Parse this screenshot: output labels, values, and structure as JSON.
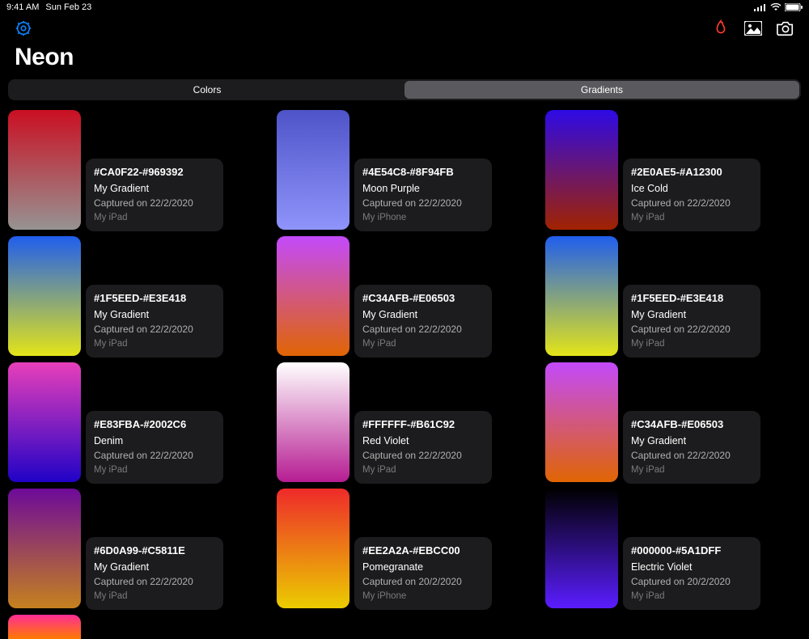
{
  "status": {
    "time": "9:41 AM",
    "date": "Sun Feb 23"
  },
  "title": "Neon",
  "segments": {
    "left": "Colors",
    "right": "Gradients"
  },
  "cards": [
    [
      {
        "c1": "#CA0F22",
        "c2": "#969392",
        "hex": "#CA0F22-#969392",
        "name": "My Gradient",
        "captured": "Captured on 22/2/2020",
        "device": "My iPad"
      },
      {
        "c1": "#1F5EED",
        "c2": "#E3E418",
        "hex": "#1F5EED-#E3E418",
        "name": "My Gradient",
        "captured": "Captured on 22/2/2020",
        "device": "My iPad"
      },
      {
        "c1": "#E83FBA",
        "c2": "#2002C6",
        "hex": "#E83FBA-#2002C6",
        "name": "Denim",
        "captured": "Captured on 22/2/2020",
        "device": "My iPad"
      },
      {
        "c1": "#6D0A99",
        "c2": "#C5811E",
        "hex": "#6D0A99-#C5811E",
        "name": "My Gradient",
        "captured": "Captured on 22/2/2020",
        "device": "My iPad"
      }
    ],
    [
      {
        "c1": "#4E54C8",
        "c2": "#8F94FB",
        "hex": "#4E54C8-#8F94FB",
        "name": "Moon Purple",
        "captured": "Captured on 22/2/2020",
        "device": "My iPhone"
      },
      {
        "c1": "#C34AFB",
        "c2": "#E06503",
        "hex": "#C34AFB-#E06503",
        "name": "My Gradient",
        "captured": "Captured on 22/2/2020",
        "device": "My iPad"
      },
      {
        "c1": "#FFFFFF",
        "c2": "#B61C92",
        "hex": "#FFFFFF-#B61C92",
        "name": "Red Violet",
        "captured": "Captured on 22/2/2020",
        "device": "My iPad"
      },
      {
        "c1": "#EE2A2A",
        "c2": "#EBCC00",
        "hex": "#EE2A2A-#EBCC00",
        "name": "Pomegranate",
        "captured": "Captured on 20/2/2020",
        "device": "My iPhone"
      }
    ],
    [
      {
        "c1": "#2E0AE5",
        "c2": "#A12300",
        "hex": "#2E0AE5-#A12300",
        "name": "Ice Cold",
        "captured": "Captured on 22/2/2020",
        "device": "My iPad"
      },
      {
        "c1": "#1F5EED",
        "c2": "#E3E418",
        "hex": "#1F5EED-#E3E418",
        "name": "My Gradient",
        "captured": "Captured on 22/2/2020",
        "device": "My iPad"
      },
      {
        "c1": "#C34AFB",
        "c2": "#E06503",
        "hex": "#C34AFB-#E06503",
        "name": "My Gradient",
        "captured": "Captured on 22/2/2020",
        "device": "My iPad"
      },
      {
        "c1": "#000000",
        "c2": "#5A1DFF",
        "hex": "#000000-#5A1DFF",
        "name": "Electric Violet",
        "captured": "Captured on 20/2/2020",
        "device": "My iPad"
      }
    ]
  ],
  "partial": {
    "c1": "#FF2D95",
    "c2": "#FF7A00"
  }
}
